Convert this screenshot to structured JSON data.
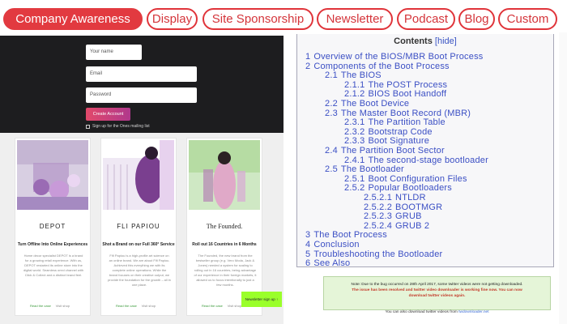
{
  "nav": {
    "items": [
      {
        "label": "Company Awareness",
        "active": true
      },
      {
        "label": "Display"
      },
      {
        "label": "Site Sponsorship"
      },
      {
        "label": "Newsletter"
      },
      {
        "label": "Podcast"
      },
      {
        "label": "Blog"
      },
      {
        "label": "Custom"
      }
    ],
    "accent_color": "#e23a40"
  },
  "signup": {
    "name_placeholder": "Your name",
    "email_placeholder": "Email",
    "password_placeholder": "Password",
    "create_button": "Create Account",
    "newsletter_opt": "Sign up for the Ones mailing list"
  },
  "cards": [
    {
      "name": "DEPOT",
      "subtitle": "Turn Offline Into Online Experiences",
      "description": "Home decor specialist DEPOT is a brand for a growing retail experience. With us, DEPOT restarted its online store into the digital world. Seamless omni channel with Click & Collect and a distinct brand feel.",
      "read_label": "Read the case",
      "visit_label": "Visit shop"
    },
    {
      "name": "FLI PAPIOU",
      "subtitle": "Shot a Brand on our Full 360° Service",
      "description": "Fifi Papiou is a high-profile art science on an online brand. We are about Fifi Papiou. Achieved this everything we with its complete online operations. While the brand focuses on their creative output, we provide the foundation for the growth – all in one place.",
      "read_label": "Read the case",
      "visit_label": "Visit shop"
    },
    {
      "name": "The Founded.",
      "subtitle": "Roll out 16 Countries in 6 Months",
      "description": "The Founded, the new brand from the bestseller group (e.g. Vero Moda, Jack & Jones) needed a system for scaling to rolling out in 16 countries, being advantage of our experience in their foreign markets, it allowed us to focus intentionally to just a few months.",
      "read_label": "Read the case",
      "visit_label": "Visit shop"
    }
  ],
  "newsletter_btn": "Newsletter sign up ↑",
  "toc": {
    "title": "Contents",
    "hide": "[hide]",
    "items": [
      {
        "num": "1",
        "text": "Overview of the BIOS/MBR Boot Process",
        "level": 0
      },
      {
        "num": "2",
        "text": "Components of the Boot Process",
        "level": 0
      },
      {
        "num": "2.1",
        "text": "The BIOS",
        "level": 1
      },
      {
        "num": "2.1.1",
        "text": "The POST Process",
        "level": 2
      },
      {
        "num": "2.1.2",
        "text": "BIOS Boot Handoff",
        "level": 2
      },
      {
        "num": "2.2",
        "text": "The Boot Device",
        "level": 1
      },
      {
        "num": "2.3",
        "text": "The Master Boot Record (MBR)",
        "level": 1
      },
      {
        "num": "2.3.1",
        "text": "The Partition Table",
        "level": 2
      },
      {
        "num": "2.3.2",
        "text": "Bootstrap Code",
        "level": 2
      },
      {
        "num": "2.3.3",
        "text": "Boot Signature",
        "level": 2
      },
      {
        "num": "2.4",
        "text": "The Partition Boot Sector",
        "level": 1
      },
      {
        "num": "2.4.1",
        "text": "The second-stage bootloader",
        "level": 2
      },
      {
        "num": "2.5",
        "text": "The Bootloader",
        "level": 1
      },
      {
        "num": "2.5.1",
        "text": "Boot Configuration Files",
        "level": 2
      },
      {
        "num": "2.5.2",
        "text": "Popular Bootloaders",
        "level": 2
      },
      {
        "num": "2.5.2.1",
        "text": "NTLDR",
        "level": 3
      },
      {
        "num": "2.5.2.2",
        "text": "BOOTMGR",
        "level": 3
      },
      {
        "num": "2.5.2.3",
        "text": "GRUB",
        "level": 3
      },
      {
        "num": "2.5.2.4",
        "text": "GRUB 2",
        "level": 3
      },
      {
        "num": "3",
        "text": "The Boot Process",
        "level": 0
      },
      {
        "num": "4",
        "text": "Conclusion",
        "level": 0
      },
      {
        "num": "5",
        "text": "Troubleshooting the Bootloader",
        "level": 0
      },
      {
        "num": "6",
        "text": "See Also",
        "level": 0
      }
    ]
  },
  "notice": {
    "line1": "Note: Due to the bug occurred on 28th April 2017, some twitter videos were not getting downloaded.",
    "line2": "The issue has been resolved and twitter video downloader is working fine now. You can now",
    "line3": "download twitter videos again.",
    "after_text": "You can also download twitter videos from",
    "after_link": "twdownloader.net"
  }
}
